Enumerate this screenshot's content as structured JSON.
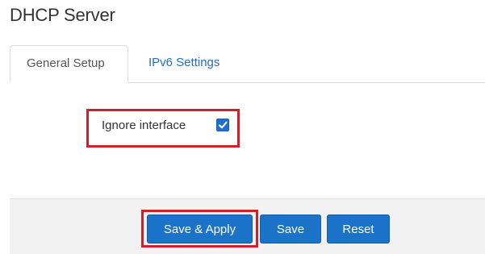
{
  "page": {
    "title": "DHCP Server"
  },
  "tabs": [
    {
      "label": "General Setup",
      "active": true
    },
    {
      "label": "IPv6 Settings",
      "active": false
    }
  ],
  "form": {
    "ignore_interface": {
      "label": "Ignore interface",
      "checked": true
    }
  },
  "footer": {
    "save_apply_label": "Save & Apply",
    "save_label": "Save",
    "reset_label": "Reset"
  },
  "colors": {
    "accent": "#1a73c9",
    "tab_link": "#1f70c1",
    "highlight": "#d0212a",
    "footer_bg": "#f2f2f2"
  }
}
